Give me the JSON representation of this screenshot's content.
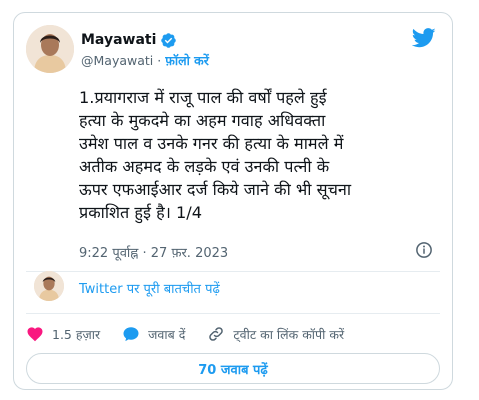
{
  "tweet": {
    "author_name": "Mayawati",
    "handle": "@Mayawati",
    "separator": "·",
    "follow_label": "फ़ॉलो करें",
    "text_lines": [
      "1.प्रयागराज में राजू पाल की वर्षों पहले हुई",
      "हत्या के मुकदमे का अहम गवाह अधिवक्ता",
      "उमेश पाल व उनके गनर की हत्या के मामले में",
      "अतीक अहमद के लड़के एवं उनकी पत्नी के",
      "ऊपर एफआईआर दर्ज किये जाने की भी सूचना",
      "प्रकाशित हुई है। 1/4"
    ],
    "timestamp": "9:22 पूर्वाह्न · 27 फ़र. 2023",
    "conversation_link": "Twitter पर पूरी बातचीत पढ़ें",
    "like_count": "1.5 हज़ार",
    "reply_label": "जवाब दें",
    "copy_link_label": "ट्वीट का लिंक कॉपी करें",
    "more_replies_label": "70 जवाब पढ़ें"
  },
  "colors": {
    "accent": "#1d9bf0",
    "like": "#f91880",
    "text": "#0f1419",
    "muted": "#536471"
  },
  "icons": {
    "brand": "twitter-bird-icon",
    "verified": "verified-badge-icon",
    "info": "info-icon",
    "like": "heart-icon",
    "reply": "speech-bubble-icon",
    "link": "link-icon"
  }
}
